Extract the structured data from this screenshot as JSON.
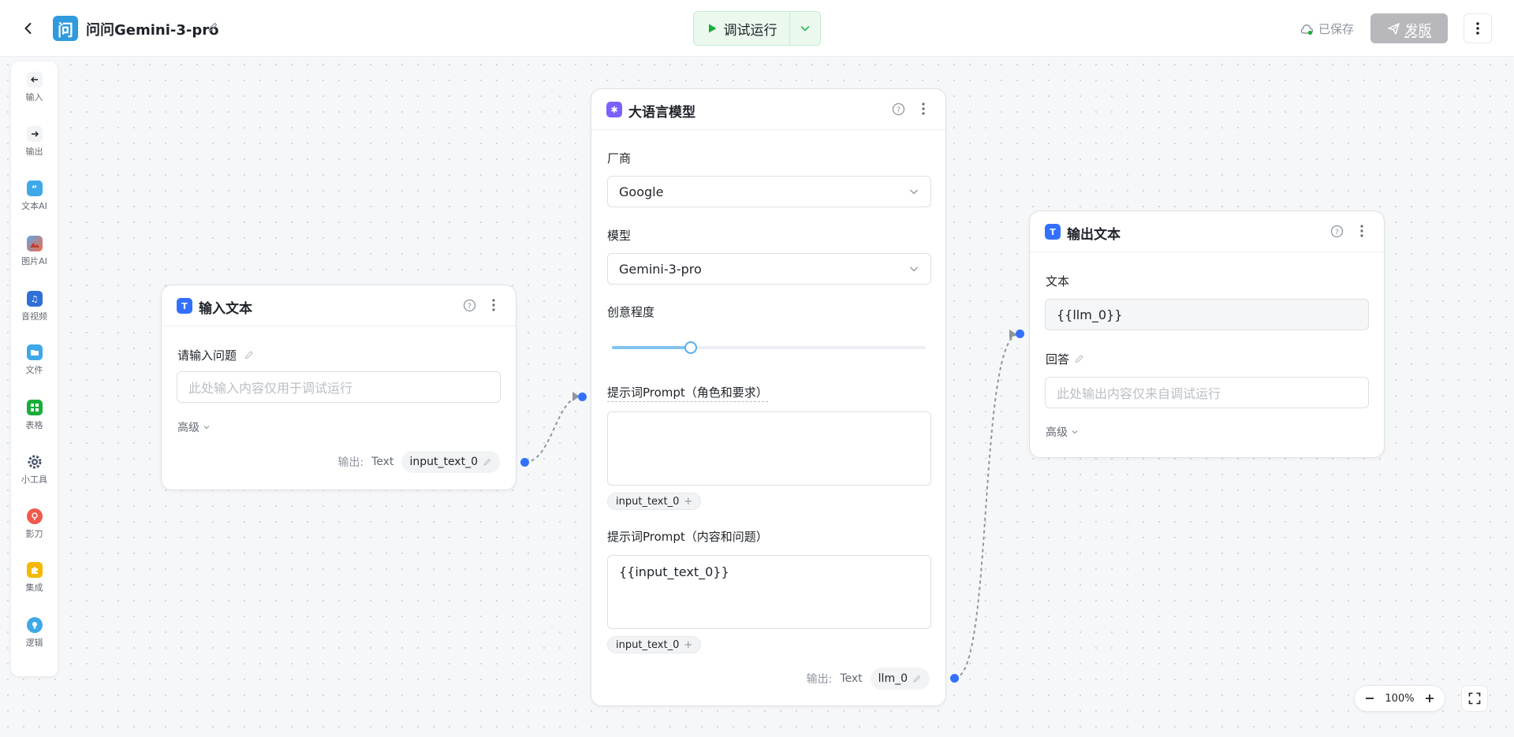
{
  "header": {
    "logo_char": "问",
    "title": "问问Gemini-3-pro",
    "run_label": "调试运行",
    "saved_label": "已保存",
    "publish_label": "发版"
  },
  "toolbar": {
    "items": [
      {
        "label": "输入",
        "icon": "arrow-left-icon"
      },
      {
        "label": "输出",
        "icon": "arrow-right-icon"
      },
      {
        "label": "文本AI",
        "icon": "quote-icon"
      },
      {
        "label": "图片AI",
        "icon": "image-icon"
      },
      {
        "label": "音视频",
        "icon": "media-icon"
      },
      {
        "label": "文件",
        "icon": "folder-icon"
      },
      {
        "label": "表格",
        "icon": "table-icon"
      },
      {
        "label": "小工具",
        "icon": "gear-icon"
      },
      {
        "label": "影刀",
        "icon": "bot-icon"
      },
      {
        "label": "集成",
        "icon": "puzzle-icon"
      },
      {
        "label": "逻辑",
        "icon": "bulb-icon"
      }
    ]
  },
  "input_node": {
    "title": "输入文本",
    "question_label": "请输入问题",
    "question_placeholder": "此处输入内容仅用于调试运行",
    "advanced_label": "高级",
    "output_label": "输出:",
    "output_type": "Text",
    "output_var": "input_text_0"
  },
  "llm_node": {
    "title": "大语言模型",
    "vendor_label": "厂商",
    "vendor_value": "Google",
    "model_label": "模型",
    "model_value": "Gemini-3-pro",
    "creativity_label": "创意程度",
    "creativity_value": 0.25,
    "system_prompt_label": "提示词Prompt（角色和要求）",
    "system_prompt_value": "",
    "system_chip": "input_text_0",
    "user_prompt_label": "提示词Prompt（内容和问题）",
    "user_prompt_value": "{{input_text_0}}",
    "user_chip": "input_text_0",
    "output_label": "输出:",
    "output_type": "Text",
    "output_var": "llm_0"
  },
  "output_node": {
    "title": "输出文本",
    "text_label": "文本",
    "text_value": "{{llm_0}}",
    "answer_label": "回答",
    "answer_placeholder": "此处输出内容仅来自调试运行",
    "advanced_label": "高级"
  },
  "zoom": {
    "value": "100%"
  },
  "colors": {
    "accent": "#3370ff",
    "run_green": "#1aad3b",
    "node_icon_blue": "#3370ff",
    "llm_icon_purple": "#7b61ff",
    "publish_gray": "#b8b8bc"
  }
}
